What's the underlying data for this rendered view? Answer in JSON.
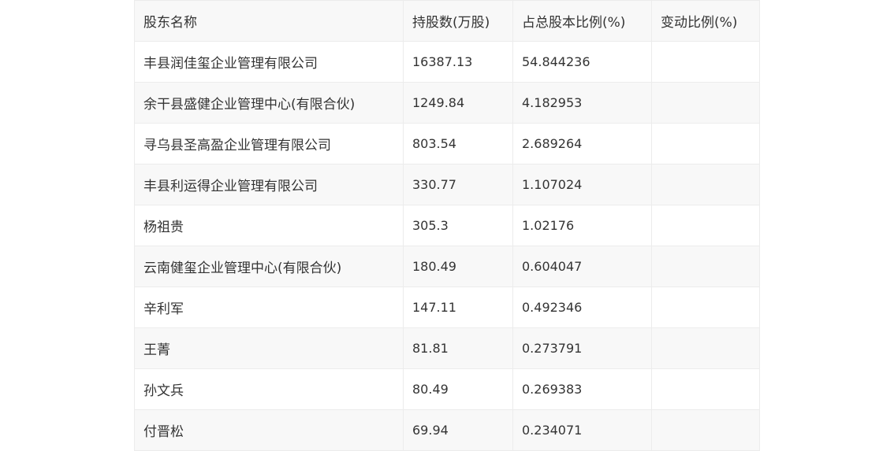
{
  "table": {
    "headers": [
      "股东名称",
      "持股数(万股)",
      "占总股本比例(%)",
      "变动比例(%)"
    ],
    "rows": [
      [
        "丰县润佳玺企业管理有限公司",
        "16387.13",
        "54.844236",
        ""
      ],
      [
        "余干县盛健企业管理中心(有限合伙)",
        "1249.84",
        "4.182953",
        ""
      ],
      [
        "寻乌县圣高盈企业管理有限公司",
        "803.54",
        "2.689264",
        ""
      ],
      [
        "丰县利运得企业管理有限公司",
        "330.77",
        "1.107024",
        ""
      ],
      [
        "杨祖贵",
        "305.3",
        "1.02176",
        ""
      ],
      [
        "云南健玺企业管理中心(有限合伙)",
        "180.49",
        "0.604047",
        ""
      ],
      [
        "辛利军",
        "147.11",
        "0.492346",
        ""
      ],
      [
        "王菁",
        "81.81",
        "0.273791",
        ""
      ],
      [
        "孙文兵",
        "80.49",
        "0.269383",
        ""
      ],
      [
        "付晋松",
        "69.94",
        "0.234071",
        ""
      ]
    ]
  }
}
